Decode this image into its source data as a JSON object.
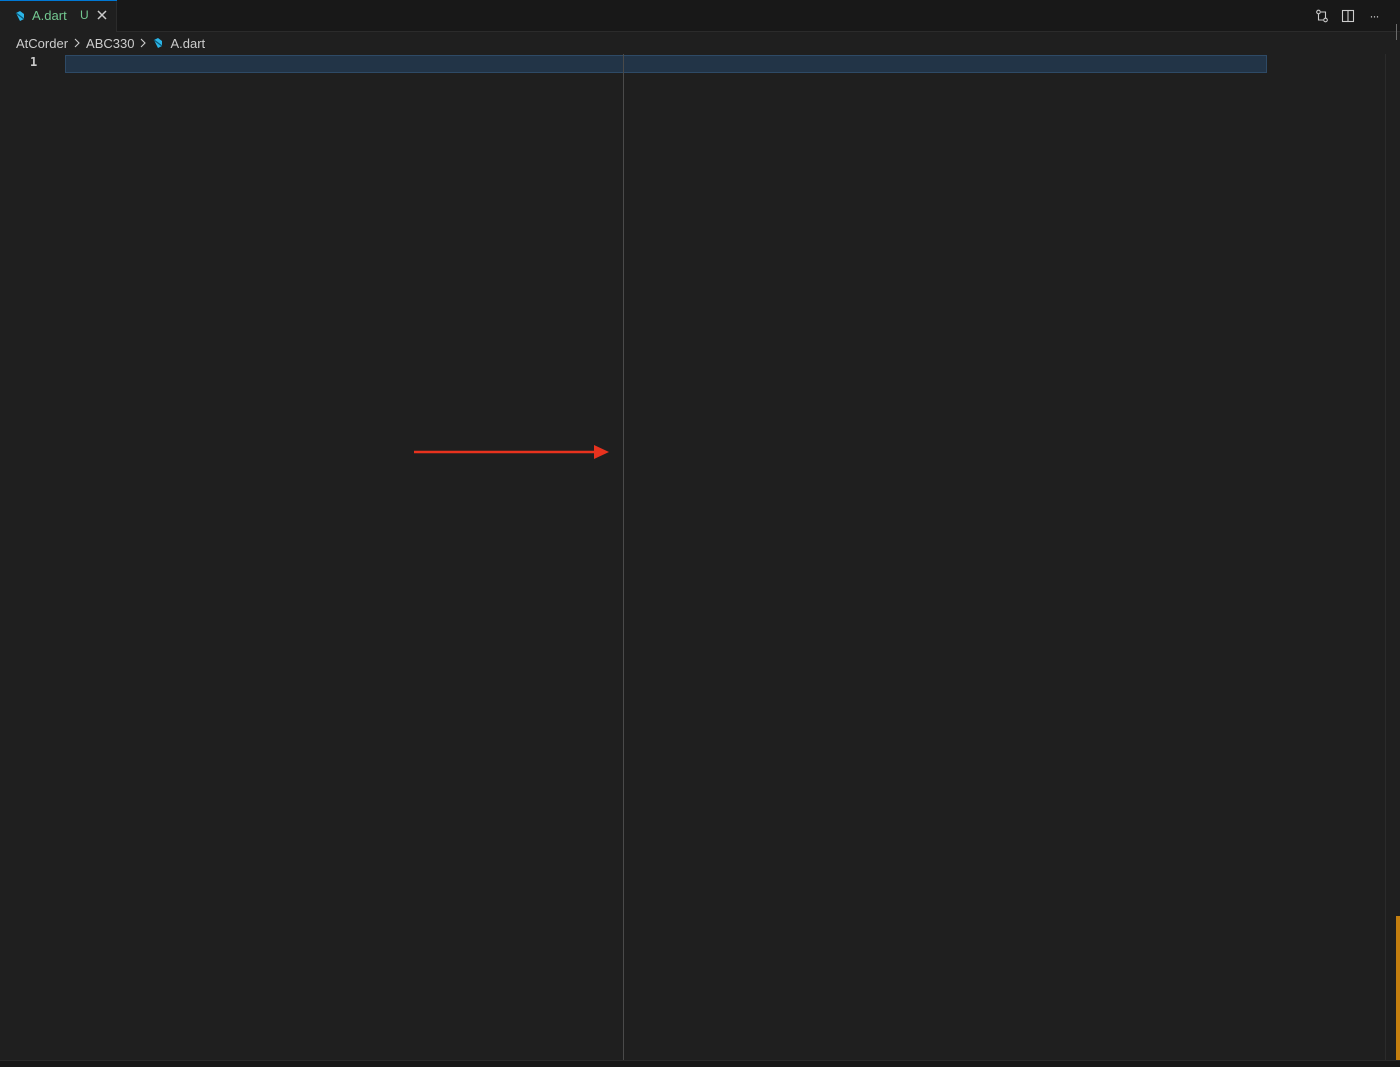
{
  "tab": {
    "label": "A.dart",
    "status": "U"
  },
  "breadcrumb": {
    "items": [
      "AtCorder",
      "ABC330",
      "A.dart"
    ]
  },
  "editor": {
    "line_numbers": [
      "1"
    ]
  },
  "icons": {
    "file": "dart-file-icon",
    "close": "close-icon",
    "compare": "compare-changes-icon",
    "split": "split-editor-icon",
    "more": "more-actions-icon",
    "chevron": "chevron-right-icon"
  },
  "colors": {
    "untracked": "#73c991",
    "dart": "#2bb5e8",
    "annotation_arrow": "#e8321e",
    "scroll_marker": "#c47f10"
  },
  "more_actions_label": "···"
}
